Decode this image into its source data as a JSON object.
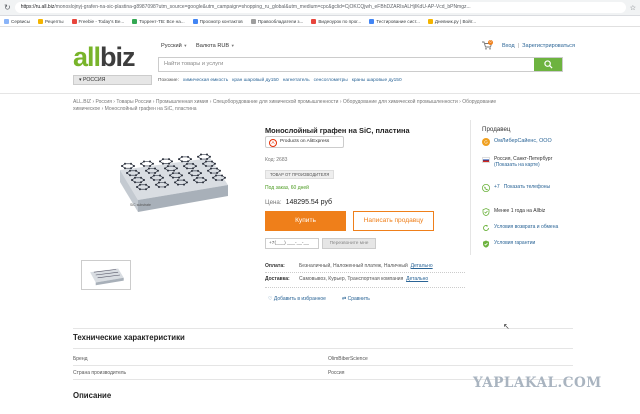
{
  "browser": {
    "url_host": "https://ru.all.biz",
    "url_rest": "/monoslojnyj-grafen-na-sic-plastina-g8987098?utm_source=google&utm_campaign=shopping_ru_global&utm_medium=cpc&gclid=CjOKCQjwh_eFBhDZARIsALHjIKdU-AP-Vcd_bPNmgz...",
    "bookmarks": [
      {
        "label": "Сервисы",
        "color": "#8ab4f8"
      },
      {
        "label": "Рецепты",
        "color": "#f4b400"
      },
      {
        "label": "Freebie - Today's Be...",
        "color": "#e8453c"
      },
      {
        "label": "Торрент-ТВ: Все на...",
        "color": "#34a853"
      },
      {
        "label": "Просмотр контактов",
        "color": "#4285f4"
      },
      {
        "label": "Правообладатели з...",
        "color": "#9e9e9e"
      },
      {
        "label": "Видеоурок по прог...",
        "color": "#e8453c"
      },
      {
        "label": "Тестирование сист...",
        "color": "#4285f4"
      },
      {
        "label": "Дневник.ру | Войт...",
        "color": "#f4b400"
      }
    ]
  },
  "header": {
    "logo_a": "all",
    "logo_b": "biz",
    "language": "Русский",
    "currency": "Валюта RUB",
    "cart_count": "0",
    "login": "Вход",
    "register": "Зарегистрироваться",
    "search_placeholder": "Найти товары и услуги",
    "region": "РОССИЯ",
    "popular_label": "Похожие:",
    "popular_links": [
      "химическая емкость",
      "кран шаровый ду150",
      "нагнетатель",
      "сенсоглометры",
      "краны шаровые ду150"
    ]
  },
  "breadcrumbs": "ALL.BIZ  ›  Россия  ›  Товары России  ›  Промышленная химия  ›  Спецоборудование для химической промышленности  ›  Оборудование для химической промышленности  ›  Оборудование химическое  ›  Монослойный графен на SiC, пластина",
  "product": {
    "title": "Монослойный графен на SiC, пластина",
    "aliexpress": "Products on AliExpress",
    "code": "Код: 2683",
    "badge": "ТОВАР ОТ ПРОИЗВОДИТЕЛЯ",
    "order": "Под заказ, 60 дней",
    "price_label": "Цена:",
    "price": "148295.54 руб",
    "buy": "Купить",
    "write": "Написать продавцу",
    "phone_placeholder": "+7(___) ___-__-__",
    "callback": "Перезвоните мне",
    "payment_label": "Оплата:",
    "payment_values": "Безналичный,  Наложенный платеж,  Наличный",
    "payment_more": "Детально",
    "delivery_label": "Доставка:",
    "delivery_values": "Самовывоз,  Курьер,  Транспортная компания",
    "delivery_more": "Детально",
    "add_fav": "Добавить в избранное",
    "compare": "Сравнить"
  },
  "seller": {
    "heading": "Продавец",
    "name": "ОмЛиберСайенс, ООО",
    "city": "Россия, Санкт-Петербург",
    "map": "(Показать на карте)",
    "phone": "+7",
    "show_phones": "Показать телефоны",
    "since": "Менее 1 года на Allbiz",
    "returns": "Условия возврата и обмена",
    "warranty": "Условия гарантии"
  },
  "specs": {
    "heading": "Технические характеристики",
    "rows": [
      {
        "k": "Бренд",
        "v": "OlimBiberScience"
      },
      {
        "k": "Страна производитель",
        "v": "Россия"
      }
    ],
    "description": "Описание"
  },
  "watermark": "YAPLAKAL.COM",
  "colors": {
    "brand_green": "#6db33f",
    "orange": "#ef7f1a",
    "link": "#2a6496"
  }
}
